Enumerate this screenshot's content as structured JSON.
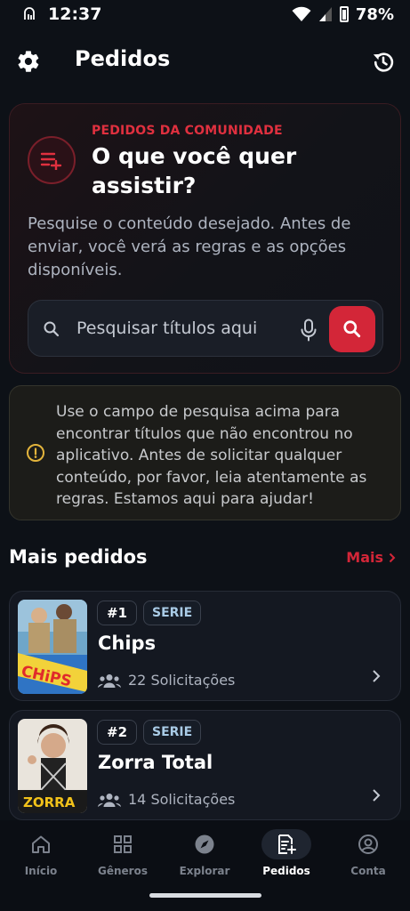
{
  "status_bar": {
    "time": "12:37",
    "battery": "78%"
  },
  "header": {
    "title": "Pedidos"
  },
  "community": {
    "kicker": "PEDIDOS DA COMUNIDADE",
    "heading": "O que você quer assistir?",
    "description": "Pesquise o conteúdo desejado. Antes de enviar, você verá as regras e as opções disponíveis.",
    "search_placeholder": "Pesquisar títulos aqui"
  },
  "info": {
    "text": "Use o campo de pesquisa acima para encontrar títulos que não encontrou no aplicativo. Antes de solicitar qualquer conteúdo, por favor, leia atentamente as regras. Estamos aqui para ajudar!"
  },
  "section": {
    "title": "Mais pedidos",
    "more_label": "Mais"
  },
  "requests": [
    {
      "rank": "#1",
      "type": "SERIE",
      "title": "Chips",
      "requests": "22 Solicitações",
      "poster_text": "CHiPS"
    },
    {
      "rank": "#2",
      "type": "SERIE",
      "title": "Zorra Total",
      "requests": "14 Solicitações",
      "poster_text": "ZORRA"
    }
  ],
  "nav": [
    {
      "label": "Início",
      "icon": "home-icon"
    },
    {
      "label": "Gêneros",
      "icon": "grid-icon"
    },
    {
      "label": "Explorar",
      "icon": "compass-icon"
    },
    {
      "label": "Pedidos",
      "icon": "request-icon",
      "active": true
    },
    {
      "label": "Conta",
      "icon": "account-icon"
    }
  ],
  "colors": {
    "accent": "#d32638",
    "background": "#0d1117",
    "info_bg": "#1c1c19"
  }
}
